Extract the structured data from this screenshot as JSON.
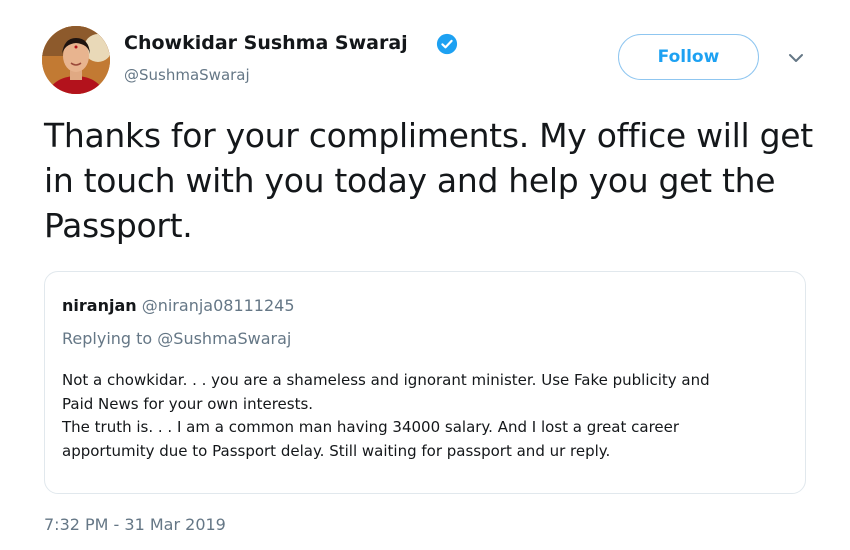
{
  "tweet": {
    "author": {
      "display_name": "Chowkidar Sushma Swaraj",
      "handle": "@SushmaSwaraj",
      "verified": true
    },
    "follow_label": "Follow",
    "text": "Thanks for your compliments. My office will get in touch with you today and help you get the Passport.",
    "timestamp": "7:32 PM - 31 Mar 2019"
  },
  "quoted_tweet": {
    "name": "niranjan",
    "handle": "@niranja08111245",
    "replying_to": "Replying to @SushmaSwaraj",
    "lines": [
      "Not a chowkidar. . . you are a shameless and ignorant minister. Use Fake publicity and",
      "Paid News for your own interests.",
      "The truth is. . . I am a common man having 34000 salary. And I lost a great career",
      "apportumity due to Passport delay. Still waiting for passport and ur reply."
    ]
  },
  "colors": {
    "accent": "#1da1f2",
    "follow_border": "#8fc6f0",
    "secondary_text": "#657786",
    "border": "#e1e8ed"
  },
  "icons": {
    "verified": "verified-badge-icon",
    "caret": "chevron-down-icon"
  }
}
